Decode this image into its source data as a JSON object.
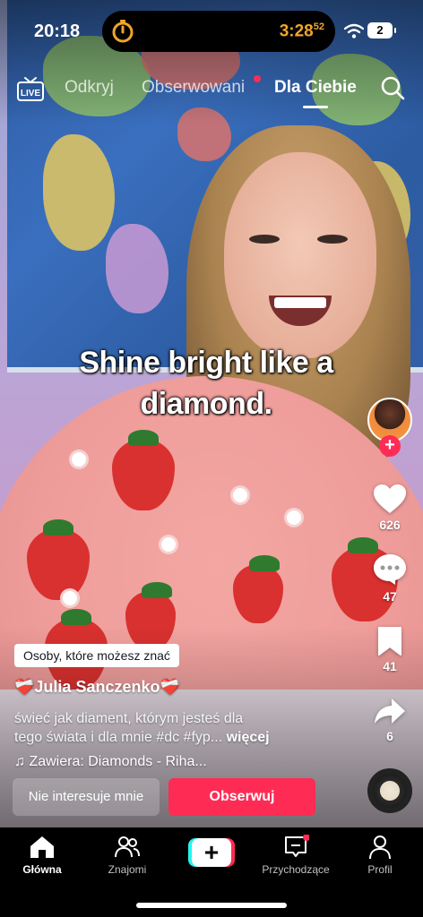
{
  "status_bar": {
    "time": "20:18",
    "timer": "3:28",
    "timer_sup": "52",
    "battery": "2"
  },
  "top_nav": {
    "live_label": "LIVE",
    "tabs": [
      "Odkryj",
      "Obserwowani",
      "Dla Ciebie"
    ],
    "active_tab": "Dla Ciebie"
  },
  "video": {
    "caption_line1": "Shine bright like a",
    "caption_line2": "diamond."
  },
  "actions": {
    "likes": "626",
    "comments": "47",
    "saves": "41",
    "shares": "6"
  },
  "post": {
    "suggestion_badge": "Osoby, które możesz znać",
    "username": "Julia Sanczenko",
    "description_line1": "świeć jak diament, którym jesteś dla",
    "description_line2": "tego świata i dla mnie #dc #fyp...",
    "more_label": "więcej",
    "sound": "Zawiera: Diamonds - Riha...",
    "not_interested_label": "Nie interesuje mnie",
    "follow_label": "Obserwuj"
  },
  "bottom_nav": {
    "items": [
      "Główna",
      "Znajomi",
      "",
      "Przychodzące",
      "Profil"
    ],
    "active": "Główna"
  },
  "colors": {
    "accent": "#fe2c55",
    "cyan": "#25f4ee",
    "timer": "#f0a52a"
  }
}
